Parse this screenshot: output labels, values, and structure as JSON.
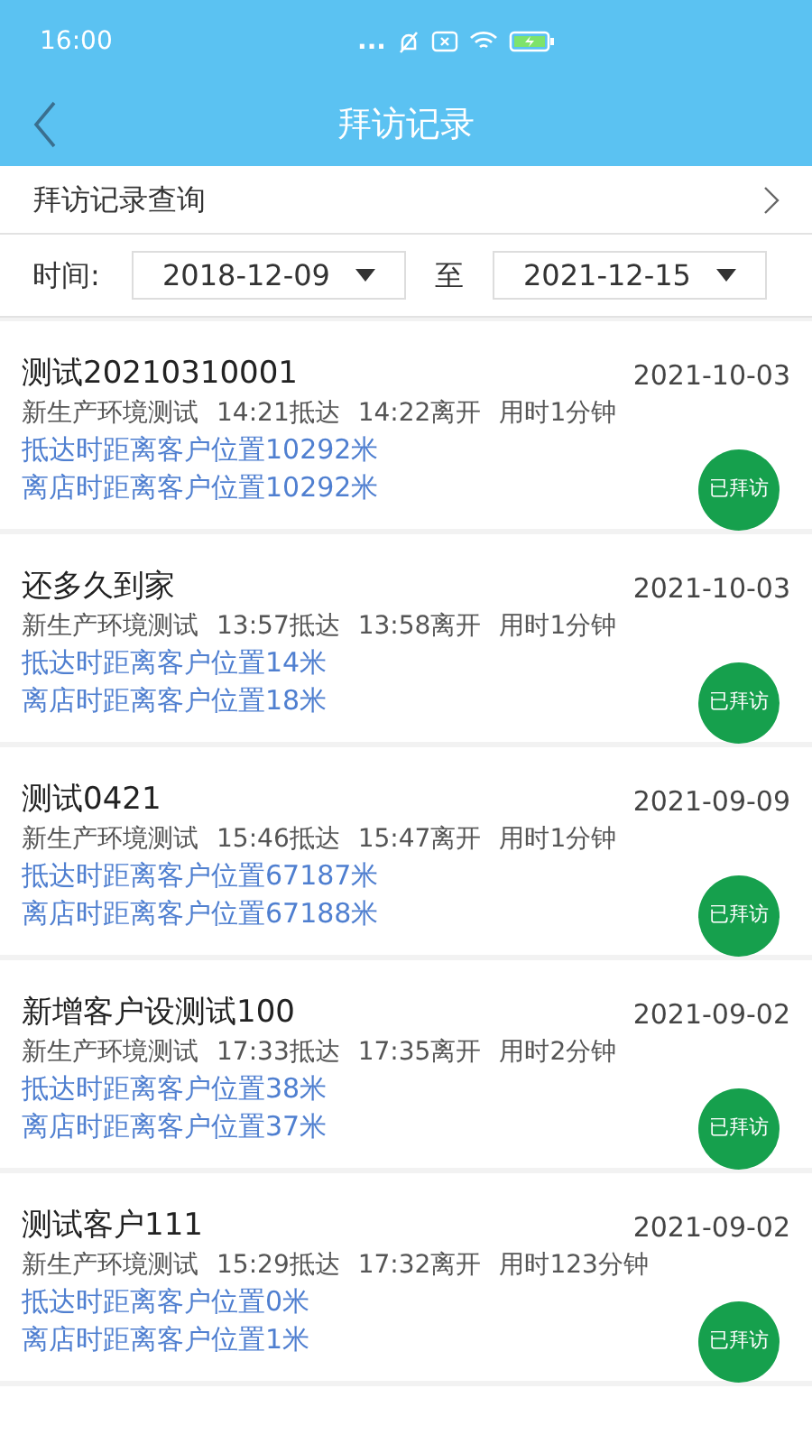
{
  "status_bar": {
    "time": "16:00",
    "dots": "..."
  },
  "header": {
    "title": "拜访记录"
  },
  "query_row": {
    "label": "拜访记录查询"
  },
  "date_filter": {
    "label": "时间:",
    "from": "2018-12-09",
    "separator": "至",
    "to": "2021-12-15"
  },
  "visits": [
    {
      "name": "测试20210310001",
      "date": "2021-10-03",
      "summary": [
        "新生产环境测试",
        "14:21抵达",
        "14:22离开",
        "用时1分钟"
      ],
      "arrive_distance": "抵达时距离客户位置10292米",
      "leave_distance": "离店时距离客户位置10292米",
      "status": "已拜访"
    },
    {
      "name": "还多久到家",
      "date": "2021-10-03",
      "summary": [
        "新生产环境测试",
        "13:57抵达",
        "13:58离开",
        "用时1分钟"
      ],
      "arrive_distance": "抵达时距离客户位置14米",
      "leave_distance": "离店时距离客户位置18米",
      "status": "已拜访"
    },
    {
      "name": "测试0421",
      "date": "2021-09-09",
      "summary": [
        "新生产环境测试",
        "15:46抵达",
        "15:47离开",
        "用时1分钟"
      ],
      "arrive_distance": "抵达时距离客户位置67187米",
      "leave_distance": "离店时距离客户位置67188米",
      "status": "已拜访"
    },
    {
      "name": "新增客户设测试100",
      "date": "2021-09-02",
      "summary": [
        "新生产环境测试",
        "17:33抵达",
        "17:35离开",
        "用时2分钟"
      ],
      "arrive_distance": "抵达时距离客户位置38米",
      "leave_distance": "离店时距离客户位置37米",
      "status": "已拜访"
    },
    {
      "name": "测试客户111",
      "date": "2021-09-02",
      "summary": [
        "新生产环境测试",
        "15:29抵达",
        "17:32离开",
        "用时123分钟"
      ],
      "arrive_distance": "抵达时距离客户位置0米",
      "leave_distance": "离店时距离客户位置1米",
      "status": "已拜访"
    }
  ]
}
